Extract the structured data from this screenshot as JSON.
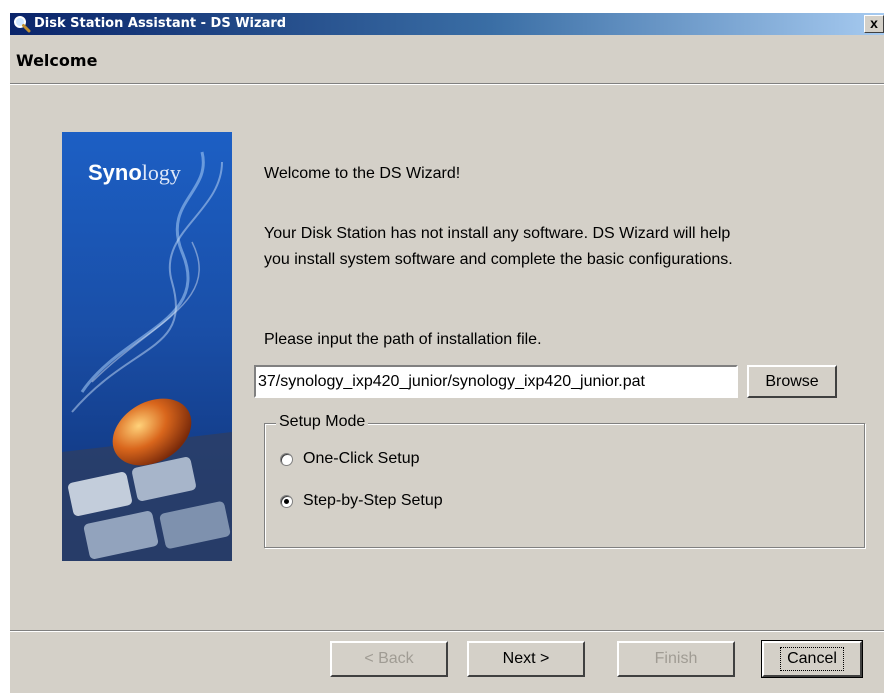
{
  "window": {
    "title": "Disk Station Assistant - DS Wizard",
    "close_label": "x"
  },
  "header": {
    "title": "Welcome"
  },
  "banner": {
    "logo_bold": "Syno",
    "logo_light": "logy"
  },
  "content": {
    "welcome": "Welcome to the DS Wizard!",
    "description_line1": "Your Disk Station has not install any software. DS Wizard will help",
    "description_line2": "you install system software and complete the basic configurations.",
    "path_prompt": "Please input the path of installation file.",
    "path_value": "37/synology_ixp420_junior/synology_ixp420_junior.pat",
    "browse_label": "Browse"
  },
  "setup_mode": {
    "legend": "Setup Mode",
    "options": [
      {
        "label": "One-Click Setup",
        "checked": false
      },
      {
        "label": "Step-by-Step Setup",
        "checked": true
      }
    ]
  },
  "footer": {
    "back_label": "< Back",
    "next_label": "Next >",
    "finish_label": "Finish",
    "cancel_label": "Cancel"
  },
  "colors": {
    "titlebar_start": "#0a246a",
    "titlebar_end": "#a6caf0",
    "dialog_bg": "#d4d0c8",
    "banner_blue": "#1a4fa8"
  },
  "icons": {
    "title_icon": "magnifier-icon"
  }
}
